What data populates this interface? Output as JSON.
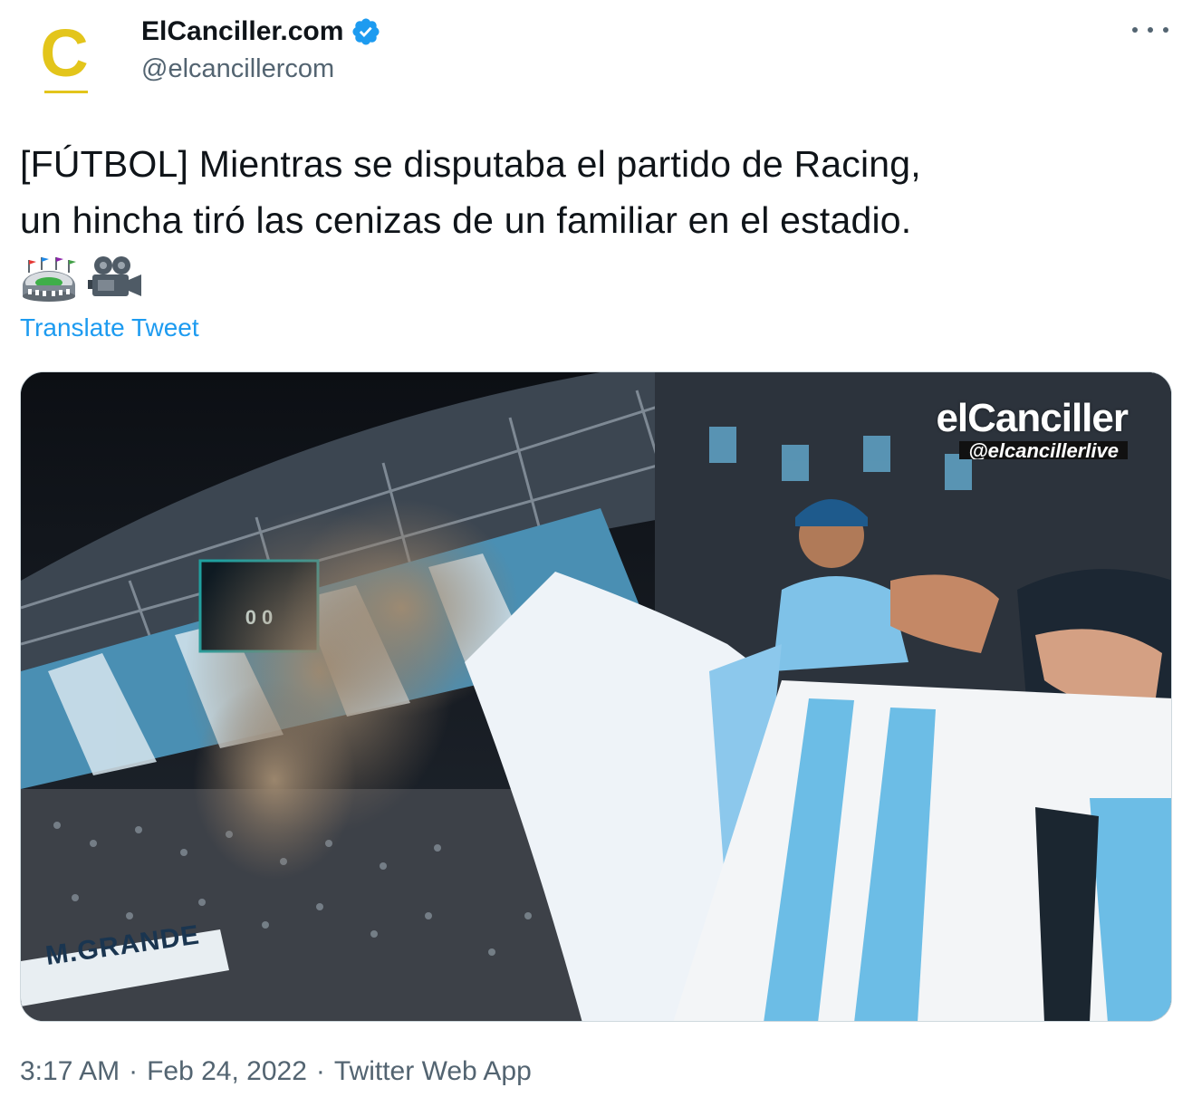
{
  "account": {
    "display_name": "ElCanciller.com",
    "handle": "@elcancillercom",
    "verified": true,
    "avatar_letter": "C",
    "avatar_color": "#e3c51b"
  },
  "menu": {
    "icon": "more-horizontal-icon"
  },
  "tweet": {
    "line1": "[FÚTBOL] Mientras se disputaba el partido de Racing,",
    "line2": "un hincha tiró las cenizas de un familiar en el estadio.",
    "emojis": [
      "stadium-emoji",
      "movie-camera-emoji"
    ],
    "translate_label": "Translate Tweet"
  },
  "media": {
    "watermark_brand": "elCanciller",
    "watermark_handle": "@elcancillerlive",
    "banner_text": "M.GRANDE",
    "scoreboard": "0 0"
  },
  "footer": {
    "time": "3:17 AM",
    "separator": "·",
    "date": "Feb 24, 2022",
    "source": "Twitter Web App"
  },
  "colors": {
    "link": "#1d9bf0",
    "secondary_text": "#536471",
    "verified_badge": "#1d9bf0",
    "sky_blue": "#6cbde6"
  }
}
